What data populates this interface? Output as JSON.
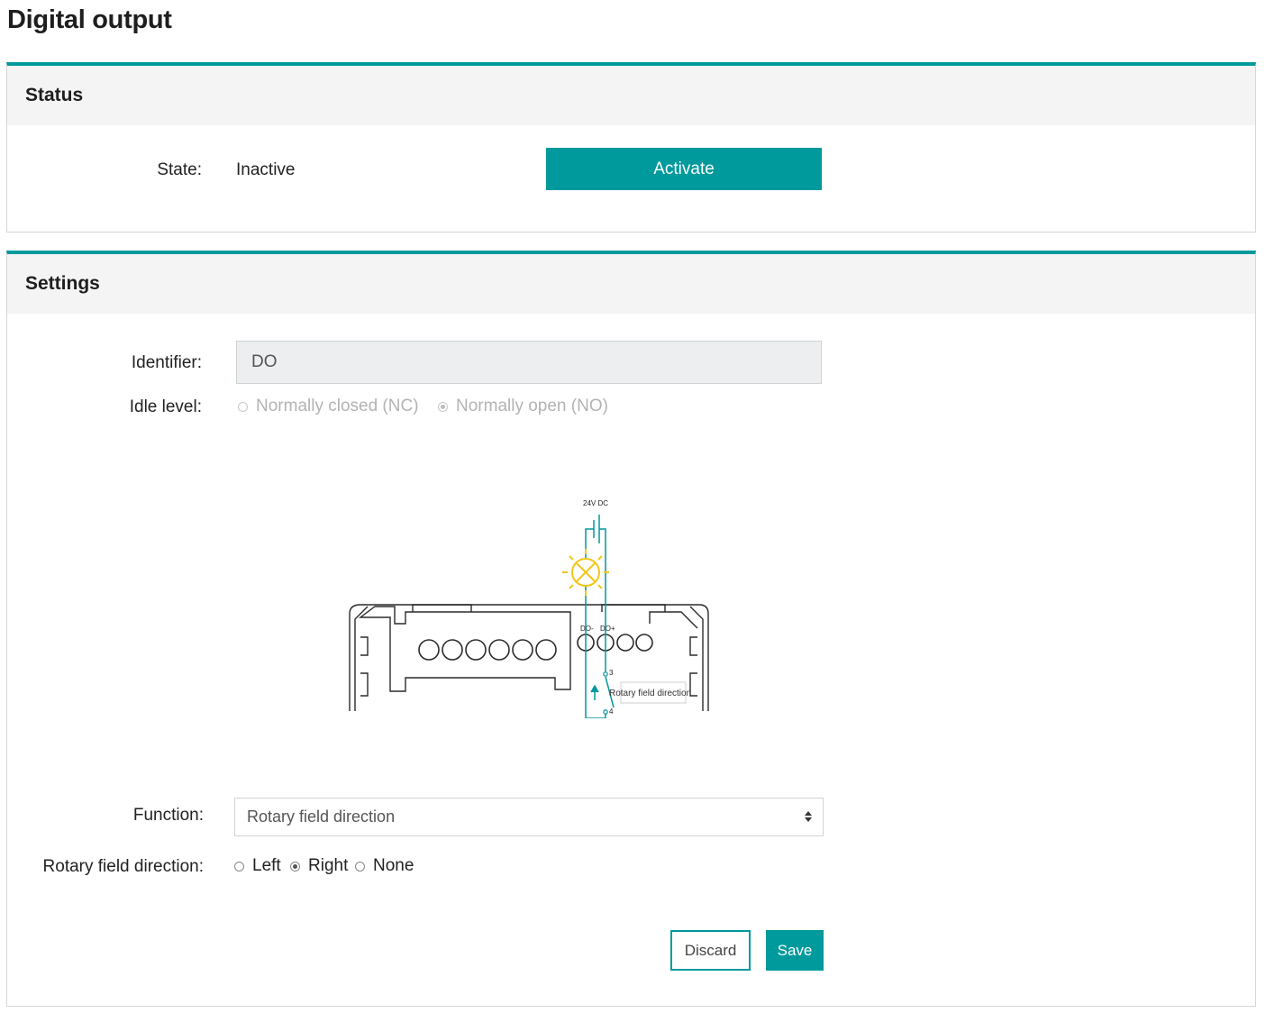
{
  "page": {
    "title": "Digital output"
  },
  "status": {
    "heading": "Status",
    "state_label": "State:",
    "state_value": "Inactive",
    "activate_label": "Activate"
  },
  "settings": {
    "heading": "Settings",
    "identifier_label": "Identifier:",
    "identifier_value": "DO",
    "idle_level_label": "Idle level:",
    "idle_options": [
      {
        "label": "Normally closed (NC)",
        "checked": false,
        "disabled": true
      },
      {
        "label": "Normally open (NO)",
        "checked": true,
        "disabled": true
      }
    ],
    "diagram": {
      "supply_label": "24V DC",
      "terminal_minus": "DO-",
      "terminal_plus": "DO+",
      "contact_top": "3",
      "contact_bottom": "4",
      "relay_label": "Rotary field direction"
    },
    "function_label": "Function:",
    "function_value": "Rotary field direction",
    "rotary_label": "Rotary field direction:",
    "rotary_options": [
      {
        "label": "Left",
        "checked": false
      },
      {
        "label": "Right",
        "checked": true
      },
      {
        "label": "None",
        "checked": false
      }
    ],
    "discard_label": "Discard",
    "save_label": "Save"
  },
  "colors": {
    "accent": "#00999c",
    "lamp": "#f5c518",
    "header_bg": "#f4f4f4"
  }
}
